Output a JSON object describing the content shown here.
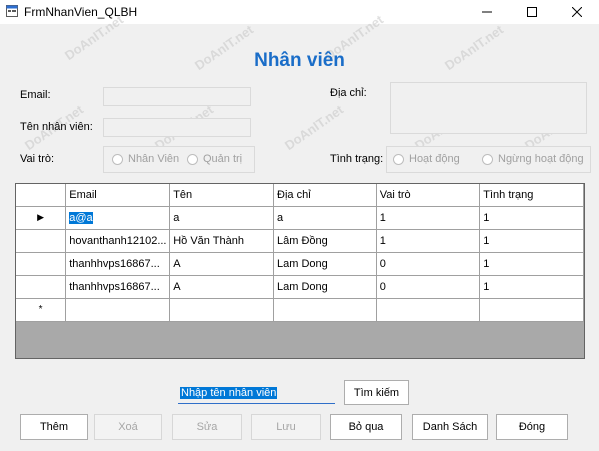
{
  "window": {
    "title": "FrmNhanVien_QLBH",
    "minimize_icon": "minimize-icon",
    "maximize_icon": "maximize-icon",
    "close_icon": "close-icon"
  },
  "form": {
    "heading": "Nhân viên",
    "email_label": "Email:",
    "email_value": "",
    "address_label": "Địa chỉ:",
    "address_value": "",
    "name_label": "Tên nhân viên:",
    "name_value": "",
    "role_label": "Vai trò:",
    "role_options": [
      "Nhân Viên",
      "Quản trị"
    ],
    "status_label": "Tình trạng:",
    "status_options": [
      "Hoạt động",
      "Ngừng hoạt động"
    ]
  },
  "grid": {
    "columns": [
      "Email",
      "Tên",
      "Địa chỉ",
      "Vai trò",
      "Tình trạng"
    ],
    "rows": [
      [
        "a@a",
        "a",
        "a",
        "1",
        "1"
      ],
      [
        "hovanthanh12102...",
        "Hồ Văn Thành",
        "Lâm Đồng",
        "1",
        "1"
      ],
      [
        "thanhhvps16867...",
        "A",
        "Lam Dong",
        "0",
        "1"
      ],
      [
        "thanhhvps16867...",
        "A",
        "Lam Dong",
        "0",
        "1"
      ]
    ],
    "current_row_indicator": "▶",
    "new_row_indicator": "*"
  },
  "search": {
    "value": "Nhập tên nhân viên",
    "button_label": "Tìm kiếm"
  },
  "buttons": {
    "add": "Thêm",
    "delete": "Xoá",
    "edit": "Sửa",
    "save": "Lưu",
    "skip": "Bỏ qua",
    "list": "Danh Sách",
    "close": "Đóng"
  },
  "watermark": "DoAnIT.net",
  "colors": {
    "accent": "#1a6dc8",
    "selection": "#0078d7"
  }
}
